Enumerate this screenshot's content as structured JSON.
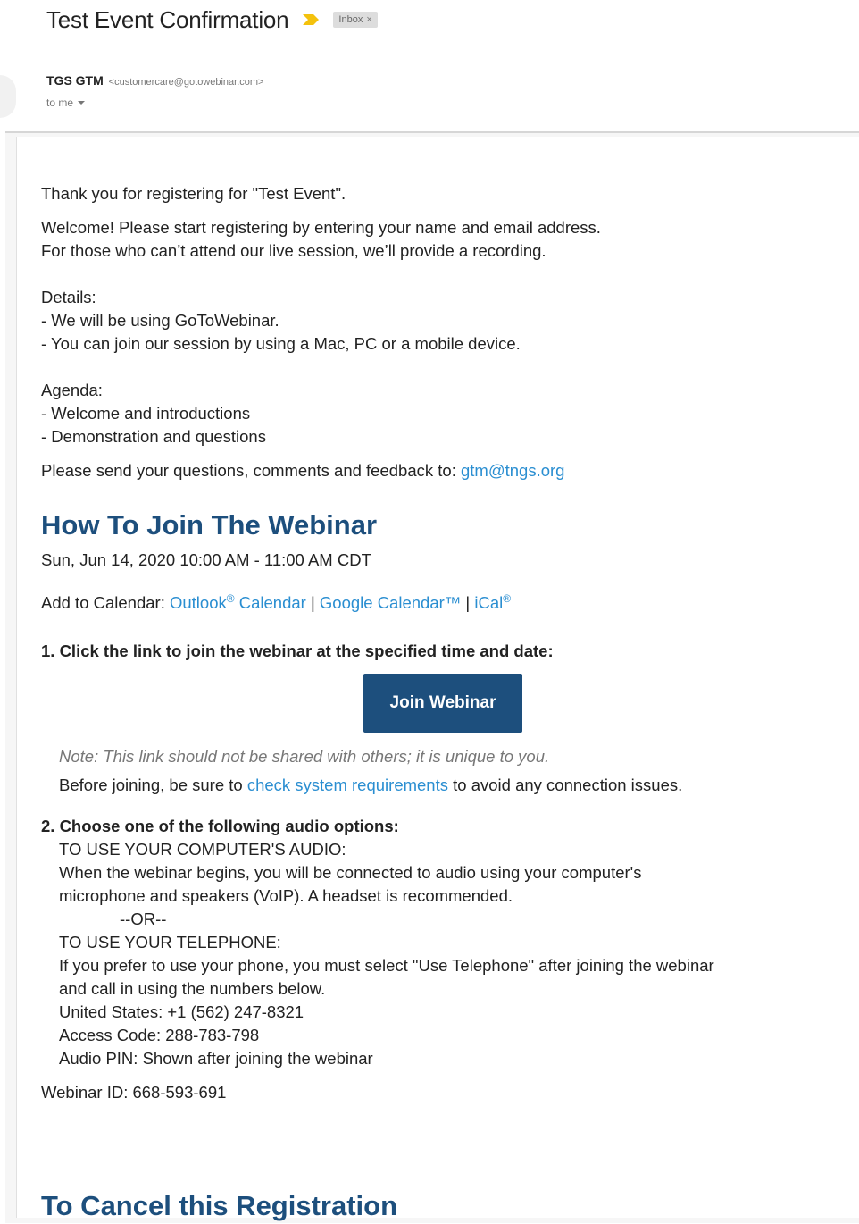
{
  "header": {
    "subject": "Test Event Confirmation",
    "label_badge": "Inbox",
    "label_remove": "×",
    "sender_name": "TGS GTM",
    "sender_email": "<customercare@gotowebinar.com>",
    "to_text": "to me"
  },
  "body": {
    "thanks": "Thank you for registering for \"Test Event\".",
    "welcome_1": "Welcome! Please start registering by entering your name and email address.",
    "welcome_2": "For those who can’t attend our live session, we’ll provide a recording.",
    "details_title": "Details:",
    "details_1": "- We will be using GoToWebinar.",
    "details_2": "- You can join our session by using a Mac, PC or a mobile device.",
    "agenda_title": "Agenda:",
    "agenda_1": "- Welcome and introductions",
    "agenda_2": "- Demonstration and questions",
    "feedback_text": "Please send your questions, comments and feedback to: ",
    "feedback_email": "gtm@tngs.org",
    "join_heading": "How To Join The Webinar",
    "datetime": "Sun, Jun 14, 2020 10:00 AM - 11:00 AM CDT",
    "add_calendar_label": "Add to Calendar: ",
    "outlook_link": "Outlook",
    "outlook_suffix": " Calendar",
    "registered_mark": "®",
    "separator": " | ",
    "google_link": "Google Calendar™",
    "ical_link": "iCal",
    "step1": "1. Click the link to join the webinar at the specified time and date:",
    "join_button": "Join Webinar",
    "note": "Note: This link should not be shared with others; it is unique to you.",
    "before_text": "Before joining, be sure to ",
    "sysreq_link": "check system requirements",
    "after_text": " to avoid any connection issues.",
    "step2": "2. Choose one of the following audio options:",
    "computer_audio_title": "TO USE YOUR COMPUTER'S AUDIO:",
    "computer_audio_1": "When the webinar begins, you will be connected to audio using your computer's",
    "computer_audio_2": "microphone and speakers (VoIP). A headset is recommended.",
    "or": "--OR--",
    "telephone_title": "TO USE YOUR TELEPHONE:",
    "telephone_1": "If you prefer to use your phone, you must select \"Use Telephone\" after joining the webinar",
    "telephone_2": "and call in using the numbers below.",
    "us_number": "United States: +1 (562) 247-8321",
    "access_code": "Access Code: 288-783-798",
    "audio_pin": "Audio PIN: Shown after joining the webinar",
    "webinar_id": "Webinar ID: 668-593-691",
    "cancel_heading": "To Cancel this Registration"
  },
  "colors": {
    "heading": "#1d4f7d",
    "link": "#2a8ed1",
    "button": "#1d4f7d",
    "important_marker": "#f4c20d"
  }
}
